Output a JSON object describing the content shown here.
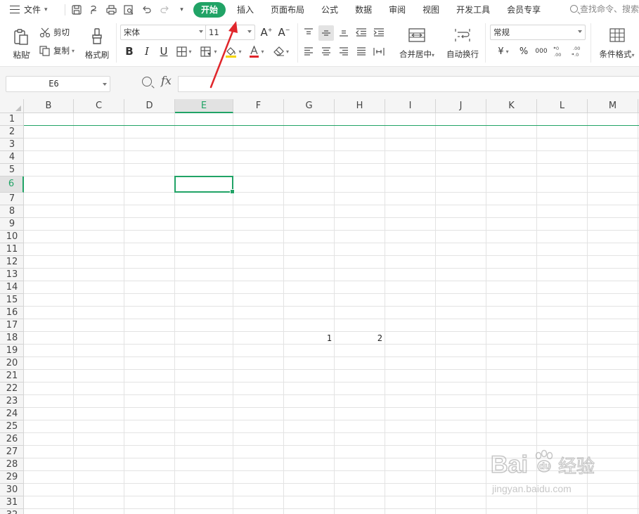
{
  "menu": {
    "file_label": "文件",
    "tabs": [
      {
        "label": "开始",
        "active": true
      },
      {
        "label": "插入",
        "active": false
      },
      {
        "label": "页面布局",
        "active": false
      },
      {
        "label": "公式",
        "active": false
      },
      {
        "label": "数据",
        "active": false
      },
      {
        "label": "审阅",
        "active": false
      },
      {
        "label": "视图",
        "active": false
      },
      {
        "label": "开发工具",
        "active": false
      },
      {
        "label": "会员专享",
        "active": false
      }
    ],
    "search_placeholder": "查找命令、搜索"
  },
  "ribbon": {
    "paste": "粘贴",
    "cut": "剪切",
    "copy": "复制",
    "format_painter": "格式刷",
    "font_name": "宋体",
    "font_size": "11",
    "bold": "B",
    "italic": "I",
    "underline": "U",
    "merge_center": "合并居中",
    "wrap_text": "自动换行",
    "number_format": "常规",
    "currency_symbol": "¥",
    "percent_symbol": "%",
    "thousands": "000",
    "conditional_format": "条件格式"
  },
  "formula_bar": {
    "name_box": "E6",
    "fx_label": "fx",
    "formula": ""
  },
  "sheet": {
    "columns": [
      "B",
      "C",
      "D",
      "E",
      "F",
      "G",
      "H",
      "I",
      "J",
      "K",
      "L",
      "M"
    ],
    "selected_column": "E",
    "rows": [
      "1",
      "2",
      "3",
      "4",
      "5",
      "6",
      "7",
      "8",
      "9",
      "10",
      "11",
      "12",
      "13",
      "14",
      "15",
      "16",
      "17",
      "18",
      "19",
      "20",
      "21",
      "22",
      "23",
      "24",
      "25",
      "26",
      "27",
      "28",
      "29",
      "30",
      "31",
      "32"
    ],
    "selected_row": "6",
    "active_cell": "E6",
    "cells": [
      {
        "ref": "G18",
        "value": "1"
      },
      {
        "ref": "H18",
        "value": "2"
      }
    ]
  },
  "colors": {
    "accent": "#21a366",
    "annotation_arrow": "#e0262b"
  },
  "watermark": {
    "brand": "Bai",
    "brand_suffix": "du",
    "cn": "经验",
    "url": "jingyan.baidu.com"
  }
}
